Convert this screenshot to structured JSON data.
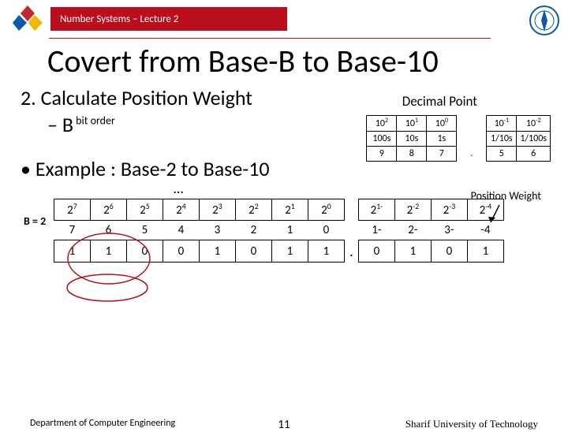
{
  "header": {
    "breadcrumb": "Number Systems – Lecture 2"
  },
  "title": "Covert from Base-B to Base-10",
  "step": {
    "num": "2.",
    "text": "Calculate Position Weight"
  },
  "sub": {
    "dash": "–",
    "base": "B",
    "sup_label": " bit order"
  },
  "decimal_label": "Decimal Point",
  "table1": {
    "row_exp": [
      "10",
      "10",
      "10",
      "10",
      "10"
    ],
    "row_exp_sup": [
      "2",
      "1",
      "0",
      "-1",
      "-2"
    ],
    "row_names": [
      "100s",
      "10s",
      "1s",
      "1/10s",
      "1/100s"
    ],
    "row_digits": [
      "9",
      "8",
      "7",
      ".",
      "5",
      "6"
    ]
  },
  "bullet": "Example : Base-2 to Base-10",
  "position_weight_label": "Position Weight",
  "ellipsis": "…",
  "b2": {
    "label": "B = 2"
  },
  "table2": {
    "exp_base": "2",
    "exp_sup": [
      "7",
      "6",
      "5",
      "4",
      "3",
      "2",
      "1",
      "0",
      "1-",
      "-2",
      "-3",
      "-4"
    ],
    "orders": [
      "7",
      "6",
      "5",
      "4",
      "3",
      "2",
      "1",
      "0",
      "1-",
      "2-",
      "3-",
      "-4"
    ],
    "digits": [
      "1",
      "1",
      "0",
      "0",
      "1",
      "0",
      "1",
      "1",
      ".",
      "0",
      "1",
      "0",
      "1"
    ]
  },
  "footer": {
    "dept": "Department of Computer Engineering",
    "page": "11",
    "univ": "Sharif University of Technology"
  }
}
